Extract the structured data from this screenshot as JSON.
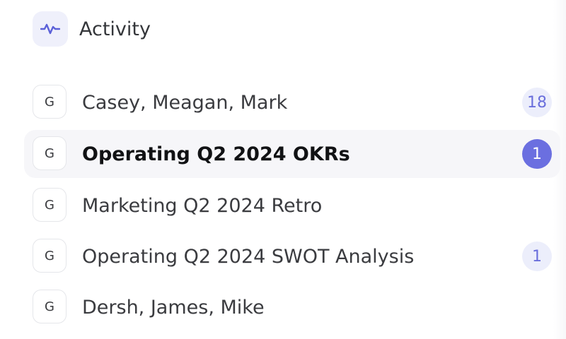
{
  "header": {
    "icon": "activity-pulse-icon",
    "label": "Activity",
    "accent_color": "#5b60d8"
  },
  "conversations": [
    {
      "avatar": "G",
      "title": "Casey, Meagan, Mark",
      "badge": "18",
      "selected": false
    },
    {
      "avatar": "G",
      "title": "Operating Q2 2024 OKRs",
      "badge": "1",
      "selected": true
    },
    {
      "avatar": "G",
      "title": "Marketing Q2 2024 Retro",
      "badge": "",
      "selected": false
    },
    {
      "avatar": "G",
      "title": "Operating Q2 2024 SWOT Analysis",
      "badge": "1",
      "selected": false
    },
    {
      "avatar": "G",
      "title": "Dersh, James, Mike",
      "badge": "",
      "selected": false
    }
  ]
}
